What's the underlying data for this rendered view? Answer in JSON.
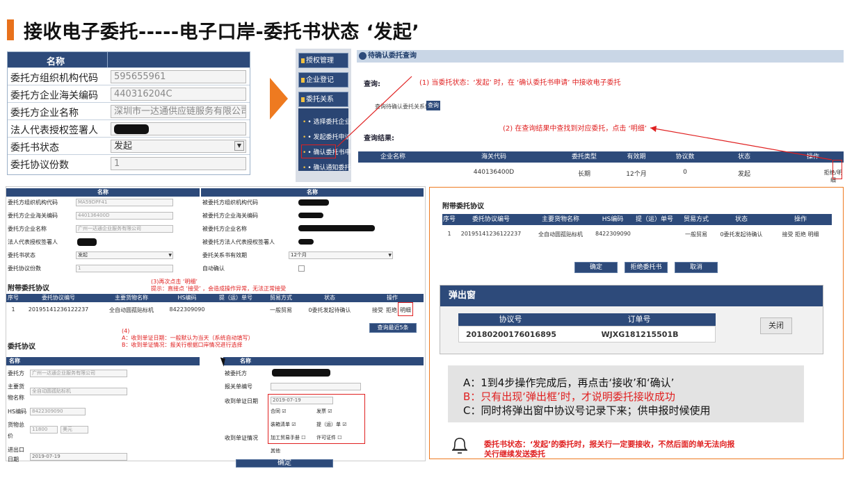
{
  "slide": {
    "title": "接收电子委托-----电子口岸-委托书状态 ‘发起’",
    "accent_color": "#e8711c",
    "header_color": "#2d4a7a"
  },
  "panel_a": {
    "header": "名称",
    "rows": [
      {
        "label": "委托方组织机构代码",
        "value": "595655961"
      },
      {
        "label": "委托方企业海关编码",
        "value": "440316204C"
      },
      {
        "label": "委托方企业名称",
        "value": "深圳市一达通供应链服务有限公司"
      },
      {
        "label": "法人代表授权签署人",
        "value": ""
      },
      {
        "label": "委托书状态",
        "value": "发起"
      },
      {
        "label": "委托协议份数",
        "value": "1"
      }
    ]
  },
  "panel_b": {
    "sidebar": [
      "授权管理",
      "企业登记",
      "委托关系"
    ],
    "submenu": [
      "• 选择委托企业",
      "• 发起委托申请",
      "• 确认委托书申请",
      "• 确认通知委托协议"
    ],
    "query_header": "待确认委托查询",
    "query_label": "查询:",
    "search_hint": "查询待确认委托关系协议",
    "search_btn": "查询",
    "result_label": "查询结果:",
    "note1": "(1) 当委托状态：‘发起’ 时，在 ‘确认委托书申请’ 中接收电子委托",
    "note2": "(2) 在查询结果中查找到对应委托，点击 ‘明细’",
    "columns": [
      "企业名称",
      "海关代码",
      "委托类型",
      "有效期",
      "协议数",
      "状态",
      "操作"
    ],
    "row": [
      "",
      "440136400D",
      "长期",
      "12个月",
      "0",
      "发起",
      "拒绝/明细"
    ]
  },
  "panel_c": {
    "left_head": "名称",
    "right_head": "名称",
    "left_rows": [
      {
        "label": "委托方组织机构代码",
        "value": "MA59DPF41"
      },
      {
        "label": "委托方企业海关编码",
        "value": "440136400D"
      },
      {
        "label": "委托方企业名称",
        "value": "广州一达通企业服务有限公司"
      },
      {
        "label": "法人代表授权签署人",
        "value": ""
      },
      {
        "label": "委托书状态",
        "value": "发起"
      },
      {
        "label": "委托协议份数",
        "value": "1"
      }
    ],
    "right_rows": [
      {
        "label": "被委托方组织机构代码",
        "value": ""
      },
      {
        "label": "被委托方企业海关编码",
        "value": ""
      },
      {
        "label": "被委托方企业名称",
        "value": ""
      },
      {
        "label": "被委托方法人代表授权签署人",
        "value": ""
      },
      {
        "label": "委托关系书有效期",
        "value": "12个月"
      },
      {
        "label": "自动确认",
        "value": ""
      }
    ],
    "agreements_title": "附带委托协议",
    "note3a": "(3)再次点击 ‘明细’",
    "note3b": "提示：直接点 ‘接受’ ，会造成操作异常，无法正常接受",
    "columns": [
      "序号",
      "委托协议编号",
      "主要货物名称",
      "HS编码",
      "提（运）单号",
      "贸易方式",
      "状态",
      "操作"
    ],
    "row": [
      "1",
      "20195141236122237",
      "全自动圆孤贴标机",
      "8422309090",
      "",
      "一般贸易",
      "0委托发起待确认",
      "接受",
      "拒绝",
      "明细"
    ],
    "recent_btn": "查询最近5条",
    "delegation_title": "委托协议",
    "note4": [
      "(4)",
      "A：收到单证日期：一般默认为当天（系统自动填写）",
      "B：收到单证情况：报关行根据口岸情况进行选择"
    ],
    "bottom_left_head": "名称",
    "bottom_right_head": "名称",
    "bottom_left": [
      {
        "label": "委托方",
        "value": "广州一达通企业服务有限公司"
      },
      {
        "label": "主要货",
        "value": ""
      },
      {
        "label": "物名称",
        "value": "全自动圆孤贴标机"
      },
      {
        "label": "HS编码",
        "value": "8422309090"
      },
      {
        "label": "货物总",
        "value": ""
      },
      {
        "label": "价",
        "value": "11800"
      },
      {
        "label": "进出口",
        "value": ""
      },
      {
        "label": "日期",
        "value": "2019-07-19"
      }
    ],
    "currency": "美元",
    "bottom_right": [
      {
        "label": "被委托方",
        "value": ""
      },
      {
        "label": "报关单编号",
        "value": ""
      },
      {
        "label": "收到单证日期",
        "value": "2019-07-19"
      },
      {
        "label": "收到单证情况",
        "value": ""
      }
    ],
    "checks": [
      "合同",
      "发票",
      "装箱清单",
      "提（运）单",
      "加工贸易手册",
      "许可证件"
    ],
    "other_label": "其他",
    "confirm": "确定"
  },
  "panel_d": {
    "title": "附带委托协议",
    "columns": [
      "序号",
      "委托协议编号",
      "主要货物名称",
      "HS编码",
      "提（运）单号",
      "贸易方式",
      "状态",
      "操作"
    ],
    "row": [
      "1",
      "20195141236122237",
      "全自动圆孤贴标机",
      "8422309090",
      "",
      "一般贸易",
      "0委托发起待确认",
      "接受 拒绝 明细"
    ],
    "buttons": [
      "确定",
      "拒绝委托书",
      "取消"
    ],
    "popup_title": "弹出窗",
    "popup_cols": [
      "协议号",
      "订单号"
    ],
    "popup_row": [
      "20180200176016895",
      "WJXG181215501B"
    ],
    "close": "关闭",
    "notes": [
      "A：1到4步操作完成后，再点击‘接收’和‘确认’",
      "B：只有出现‘弹出框’时，才说明委托接收成功",
      "C：同时将弹出窗中协议号记录下来；供申报时候使用"
    ],
    "warning_1": "委托书状态：‘发起’的委托时，报关行一定要接收，不然后面的单无法向报",
    "warning_2": "关行继续发送委托"
  }
}
